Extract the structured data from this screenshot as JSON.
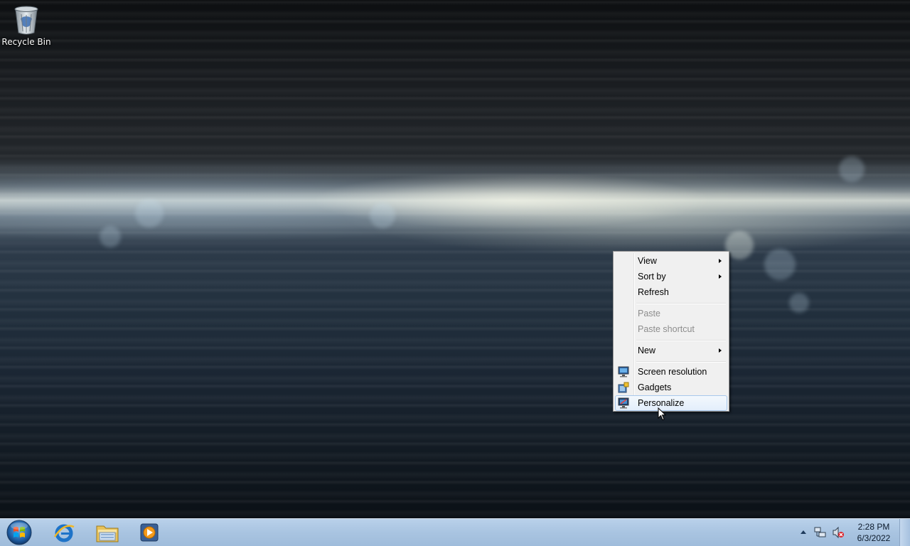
{
  "desktop": {
    "icons": [
      {
        "label": "Recycle Bin",
        "icon": "recycle-bin-icon"
      }
    ]
  },
  "context_menu": {
    "items": [
      {
        "label": "View",
        "has_submenu": true,
        "enabled": true
      },
      {
        "label": "Sort by",
        "has_submenu": true,
        "enabled": true
      },
      {
        "label": "Refresh",
        "has_submenu": false,
        "enabled": true
      },
      {
        "label": "Paste",
        "has_submenu": false,
        "enabled": false
      },
      {
        "label": "Paste shortcut",
        "has_submenu": false,
        "enabled": false
      },
      {
        "label": "New",
        "has_submenu": true,
        "enabled": true
      },
      {
        "label": "Screen resolution",
        "icon": "screen-resolution-icon",
        "enabled": true
      },
      {
        "label": "Gadgets",
        "icon": "gadgets-icon",
        "enabled": true
      },
      {
        "label": "Personalize",
        "icon": "personalize-icon",
        "enabled": true,
        "highlighted": true
      }
    ]
  },
  "taskbar": {
    "pinned": [
      {
        "name": "Internet Explorer",
        "icon": "internet-explorer-icon"
      },
      {
        "name": "Windows Explorer",
        "icon": "folder-icon"
      },
      {
        "name": "Windows Media Player",
        "icon": "media-player-icon"
      }
    ],
    "tray": {
      "icons": [
        "show-hidden-icons-arrow",
        "network-icon",
        "volume-muted-icon"
      ],
      "time": "2:28 PM",
      "date": "6/3/2022"
    }
  },
  "colors": {
    "taskbar": "#a9c4e1",
    "menu_background": "#f0f0f0",
    "menu_highlight_border": "#a8c8ec",
    "disabled_text": "#8d8d8d"
  }
}
